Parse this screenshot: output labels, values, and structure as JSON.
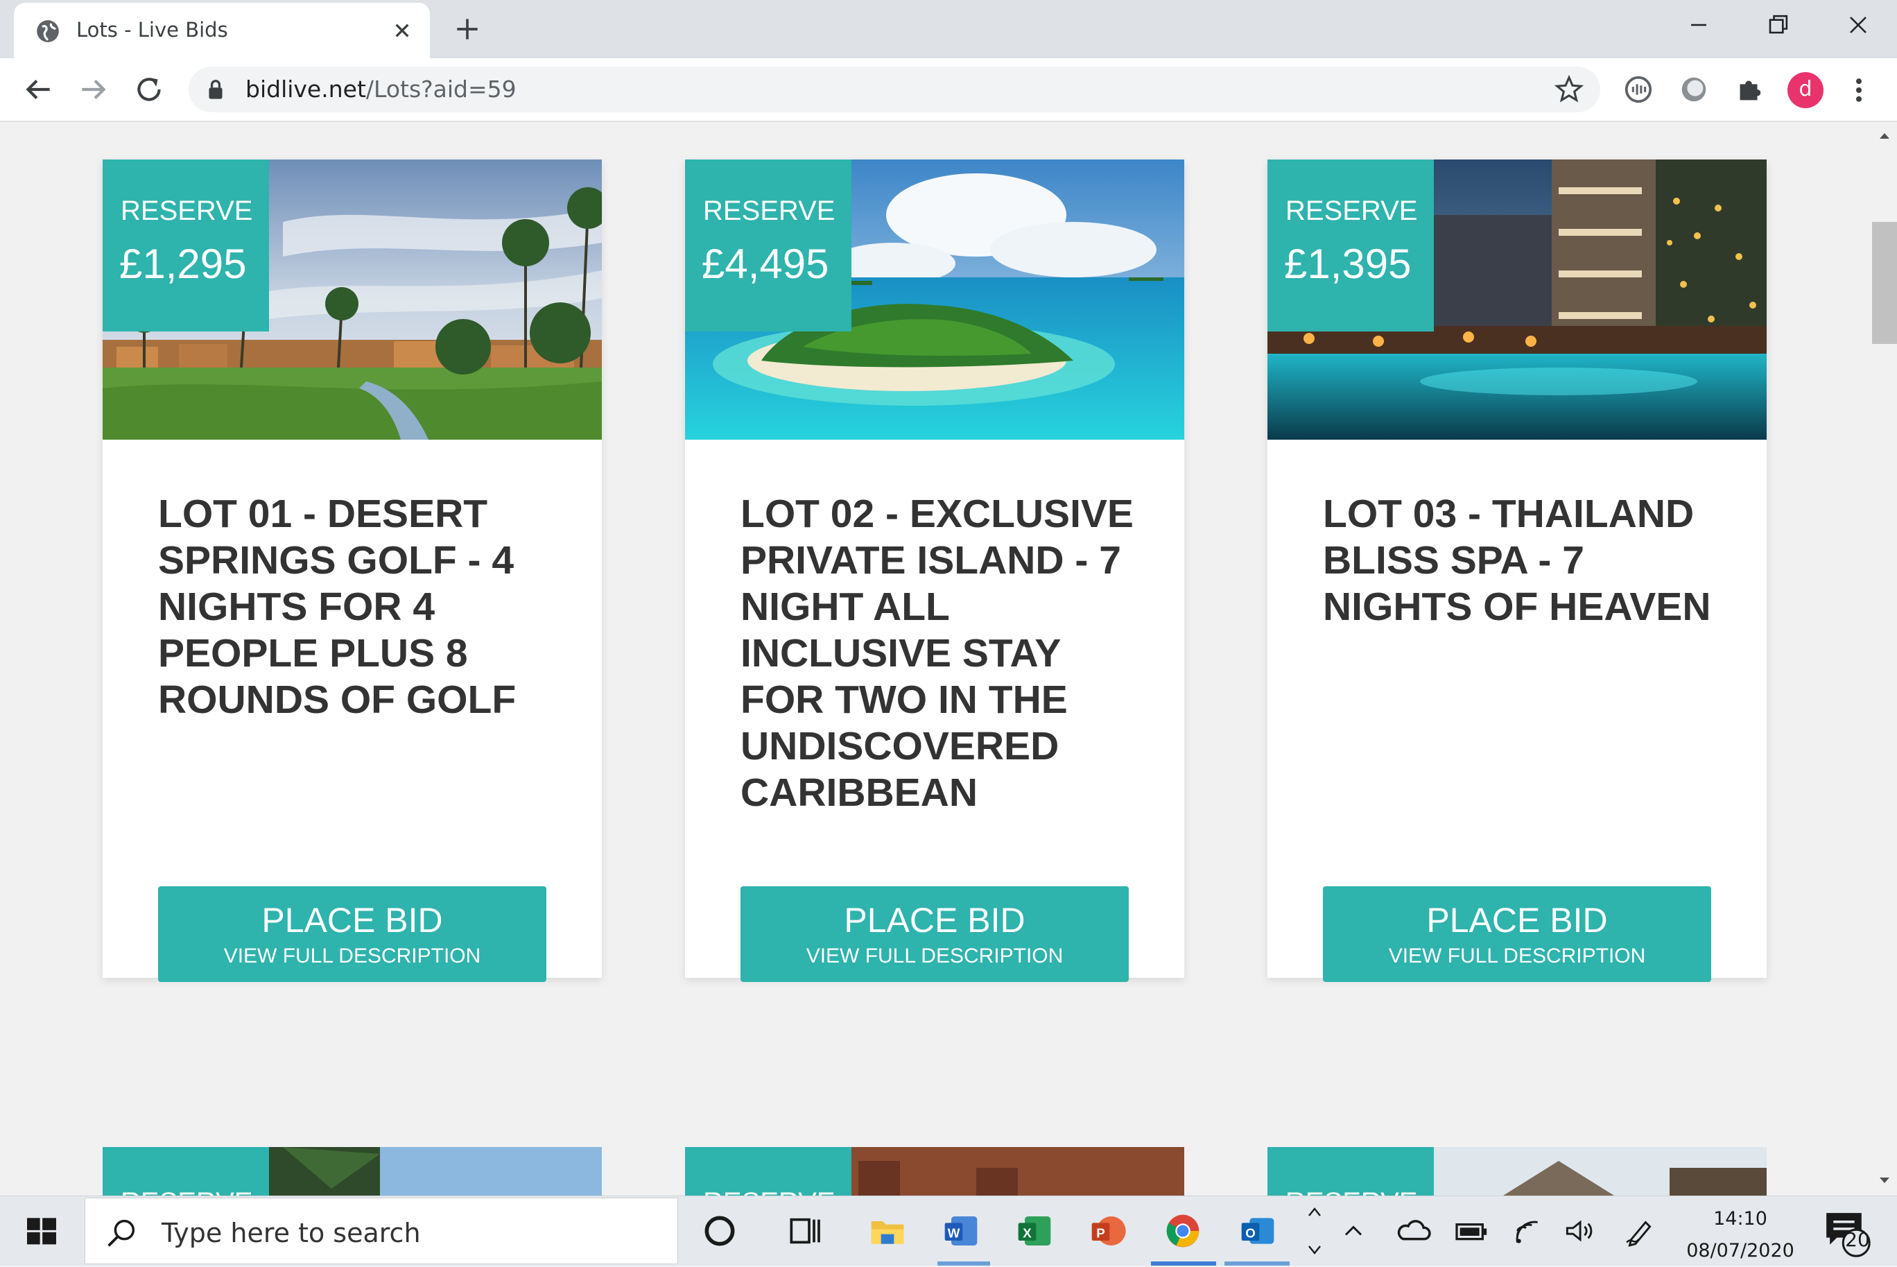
{
  "browser": {
    "tab_title": "Lots - Live Bids",
    "url_host": "bidlive.net",
    "url_path": "/Lots?aid=59",
    "profile_initial": "d"
  },
  "lots": [
    {
      "reserve_label": "RESERVE",
      "reserve_price": "£1,295",
      "title": "LOT 01 - DESERT SPRINGS GOLF - 4 NIGHTS FOR 4 PEOPLE PLUS 8 ROUNDS OF GOLF",
      "bid_label": "PLACE BID",
      "description_label": "VIEW FULL DESCRIPTION",
      "image": "golf-resort-photo"
    },
    {
      "reserve_label": "RESERVE",
      "reserve_price": "£4,495",
      "title": "LOT 02 - EXCLUSIVE PRIVATE ISLAND - 7 NIGHT ALL INCLUSIVE STAY FOR TWO IN THE UNDISCOVERED CARIBBEAN",
      "bid_label": "PLACE BID",
      "description_label": "VIEW FULL DESCRIPTION",
      "image": "tropical-island-photo"
    },
    {
      "reserve_label": "RESERVE",
      "reserve_price": "£1,395",
      "title": "LOT 03 - THAILAND BLISS SPA - 7 NIGHTS OF HEAVEN",
      "bid_label": "PLACE BID",
      "description_label": "VIEW FULL DESCRIPTION",
      "image": "spa-pool-photo"
    }
  ],
  "next_row": [
    {
      "reserve_label": "RESERVE"
    },
    {
      "reserve_label": "RESERVE"
    },
    {
      "reserve_label": "RESERVE"
    }
  ],
  "taskbar": {
    "search_placeholder": "Type here to search",
    "time": "14:10",
    "date": "08/07/2020",
    "notification_count": "20"
  },
  "colors": {
    "accent": "#2eb3ad",
    "title_text": "#333333",
    "page_bg": "#f1f1f1"
  }
}
